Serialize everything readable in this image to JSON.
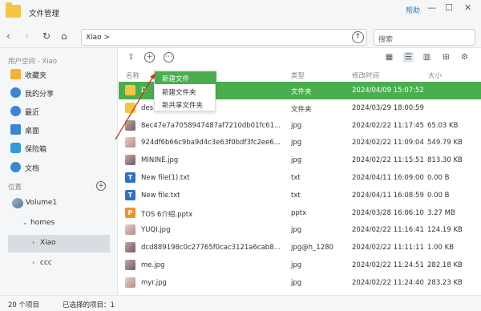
{
  "window": {
    "title": "文件管理",
    "help_label": "帮助",
    "minimize": "—",
    "maximize": "☐",
    "close": "✕"
  },
  "nav": {
    "path": "Xiao >",
    "search_placeholder": "搜索"
  },
  "sidebar": {
    "section_user": "用户空间 - Xiao",
    "items": [
      {
        "label": "收藏夹",
        "icon": "star-icon",
        "color": "#f2b233"
      },
      {
        "label": "我的分享",
        "icon": "share-icon",
        "color": "#3a86d6"
      },
      {
        "label": "最近",
        "icon": "clock-icon",
        "color": "#3a86d6"
      },
      {
        "label": "桌面",
        "icon": "desktop-icon",
        "color": "#3a86d6"
      },
      {
        "label": "保险箱",
        "icon": "safe-icon",
        "color": "#2f9bd8"
      },
      {
        "label": "文档",
        "icon": "document-icon",
        "color": "#3a86d6"
      }
    ],
    "section_location": "位置",
    "tree": {
      "volume": "Volume1",
      "homes": "homes",
      "xiao": "Xiao",
      "ccc": "ccc"
    }
  },
  "columns": {
    "name": "名称",
    "type": "类型",
    "modified": "修改时间",
    "size": "大小"
  },
  "files": [
    {
      "name": "D",
      "type": "文件夹",
      "modified": "2024/04/09 15:07:52",
      "size": "",
      "icon": "folder",
      "selected": true
    },
    {
      "name": "des",
      "type": "文件夹",
      "modified": "2024/03/29 18:00:59",
      "size": "",
      "icon": "folder",
      "selected": false
    },
    {
      "name": "8ec47e7a7058947487af7210db01fc61...",
      "type": "jpg",
      "modified": "2024/02/22 11:17:45",
      "size": "65.03 KB",
      "icon": "img",
      "selected": false
    },
    {
      "name": "924df6b66c9ba9d4c3e63f0bdf3fc2ee6...",
      "type": "jpg",
      "modified": "2024/02/22 11:09:04",
      "size": "549.79 KB",
      "icon": "img2",
      "selected": false
    },
    {
      "name": "MININE.jpg",
      "type": "jpg",
      "modified": "2024/02/22 11:15:51",
      "size": "813.30 KB",
      "icon": "img",
      "selected": false
    },
    {
      "name": "New file(1).txt",
      "type": "txt",
      "modified": "2024/04/11 16:09:00",
      "size": "0.00 B",
      "icon": "txt",
      "selected": false
    },
    {
      "name": "New file.txt",
      "type": "txt",
      "modified": "2024/04/11 16:08:59",
      "size": "0.00 B",
      "icon": "txt",
      "selected": false
    },
    {
      "name": "TOS 6介绍.pptx",
      "type": "pptx",
      "modified": "2024/03/28 16:06:10",
      "size": "3.27 MB",
      "icon": "ppt",
      "selected": false
    },
    {
      "name": "YUQI.jpg",
      "type": "jpg",
      "modified": "2024/02/22 11:16:41",
      "size": "124.19 KB",
      "icon": "img2",
      "selected": false
    },
    {
      "name": "dcd889198c0c27765f0cac3121a6cab8...",
      "type": "jpg@h_1280",
      "modified": "2024/02/22 11:11:11",
      "size": "1.00 KB",
      "icon": "img",
      "selected": false
    },
    {
      "name": "me.jpg",
      "type": "jpg",
      "modified": "2024/02/22 11:24:51",
      "size": "282.18 KB",
      "icon": "img",
      "selected": false
    },
    {
      "name": "myr.jpg",
      "type": "jpg",
      "modified": "2024/02/22 11:24:40",
      "size": "283.23 KB",
      "icon": "img2",
      "selected": false
    }
  ],
  "context_menu": [
    {
      "label": "新建文件",
      "highlighted": true
    },
    {
      "label": "新建文件夹",
      "highlighted": false
    },
    {
      "label": "新共享文件夹",
      "highlighted": false
    }
  ],
  "status": {
    "count": "20 个项目",
    "selected": "已选择的项目：1"
  }
}
